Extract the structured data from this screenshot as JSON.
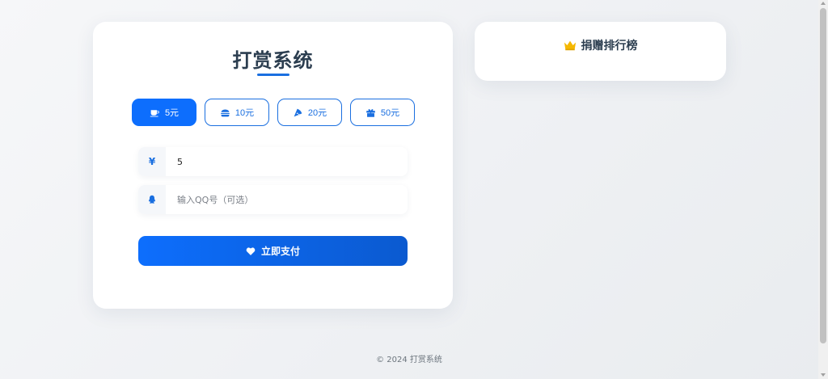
{
  "main": {
    "title": "打赏系统",
    "amounts": [
      {
        "label": "5元",
        "icon": "coffee-icon",
        "active": true
      },
      {
        "label": "10元",
        "icon": "burger-icon",
        "active": false
      },
      {
        "label": "20元",
        "icon": "pizza-icon",
        "active": false
      },
      {
        "label": "50元",
        "icon": "gift-icon",
        "active": false
      }
    ],
    "amount_field": {
      "symbol": "¥",
      "value": "5"
    },
    "qq_field": {
      "placeholder": "输入QQ号（可选）",
      "value": ""
    },
    "pay_button": "立即支付"
  },
  "ranking": {
    "title": "捐赠排行榜"
  },
  "footer": "© 2024 打赏系统",
  "colors": {
    "accent": "#0d6efd",
    "title": "#2c3e50",
    "crown": "#f5b800"
  }
}
